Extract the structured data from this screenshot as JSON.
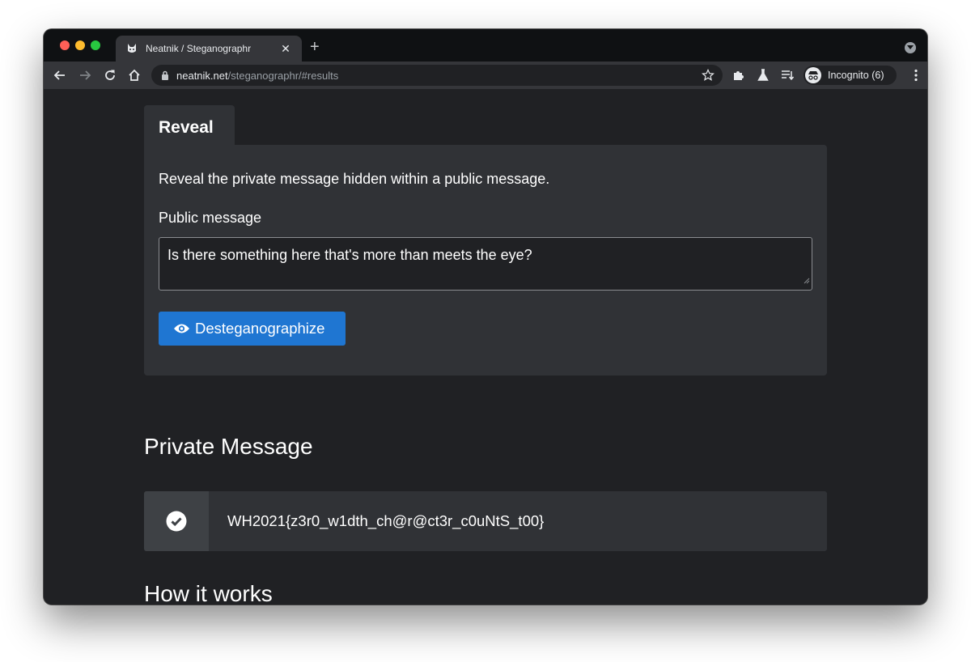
{
  "browser": {
    "tab_title": "Neatnik / Steganographr",
    "url_host": "neatnik.net",
    "url_path": "/steganographr/#results",
    "profile_label": "Incognito (6)"
  },
  "page": {
    "reveal_tab_label": "Reveal",
    "reveal_description": "Reveal the private message hidden within a public message.",
    "public_message_label": "Public message",
    "public_message_value": "Is there something here that's more than meets the eye?",
    "desteg_button_label": "Desteganographize",
    "private_message_heading": "Private Message",
    "private_message_value": "WH2021{z3r0_w1dth_ch@r@ct3r_c0uNtS_t00}",
    "how_it_works_heading": "How it works"
  },
  "colors": {
    "page_bg": "#202124",
    "panel_bg": "#303236",
    "button_blue": "#1f76d2"
  }
}
